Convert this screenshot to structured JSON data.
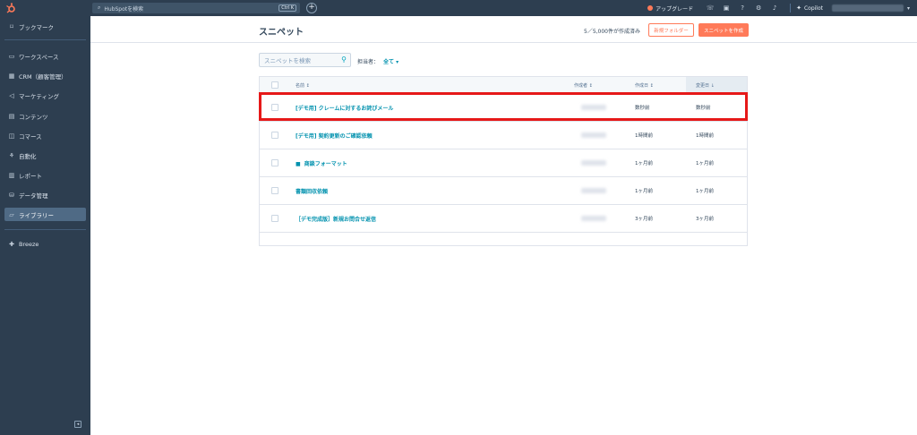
{
  "topbar": {
    "search_placeholder": "HubSpotを検索",
    "search_shortcut": "Ctrl K",
    "add_label": "+",
    "upgrade_label": "アップグレード",
    "copilot_label": "Copilot",
    "account_caret": "▾",
    "icons": [
      "phone-icon",
      "marketplace-icon",
      "help-icon",
      "settings-icon",
      "notifications-icon"
    ]
  },
  "sidebar": {
    "items": [
      {
        "label": "ブックマーク",
        "icon": "bookmark-icon"
      },
      {
        "label": "ワークスペース",
        "icon": "workspace-icon"
      },
      {
        "label": "CRM（顧客管理）",
        "icon": "crm-icon"
      },
      {
        "label": "マーケティング",
        "icon": "marketing-icon"
      },
      {
        "label": "コンテンツ",
        "icon": "content-icon"
      },
      {
        "label": "コマース",
        "icon": "commerce-icon"
      },
      {
        "label": "自動化",
        "icon": "automation-icon"
      },
      {
        "label": "レポート",
        "icon": "reports-icon"
      },
      {
        "label": "データ管理",
        "icon": "data-icon"
      },
      {
        "label": "ライブラリー",
        "icon": "library-icon",
        "active": true
      }
    ],
    "breeze_label": "Breeze"
  },
  "header": {
    "title": "スニペット",
    "usage": "5／5,000件が作成済み",
    "new_folder": "新規フォルダー",
    "create": "スニペットを作成"
  },
  "filters": {
    "search_placeholder": "スニペットを検索",
    "owner_label": "担当者：",
    "owner_value": "全て ▾"
  },
  "table": {
    "columns": [
      "名前 ↕",
      "作成者 ↕",
      "作成日 ↕",
      "変更日 ↓"
    ],
    "rows": [
      {
        "name": "[デモ用] クレームに対するお詫びメール",
        "created": "数秒前",
        "modified": "数秒前",
        "folder": false
      },
      {
        "name": "[デモ用] 契約更新のご確認依頼",
        "created": "1時間前",
        "modified": "1時間前",
        "folder": false
      },
      {
        "name": "商談フォーマット",
        "created": "1ヶ月前",
        "modified": "1ヶ月前",
        "folder": true
      },
      {
        "name": "書類回収依頼",
        "created": "1ヶ月前",
        "modified": "1ヶ月前",
        "folder": false
      },
      {
        "name": "［デモ完成版］新規お問合せ返信",
        "created": "3ヶ月前",
        "modified": "3ヶ月前",
        "folder": false
      }
    ]
  },
  "colors": {
    "topbar_bg": "#2d3e50",
    "accent_orange": "#ff7a59",
    "link_teal": "#0091ae",
    "highlight_red": "#e61919"
  }
}
